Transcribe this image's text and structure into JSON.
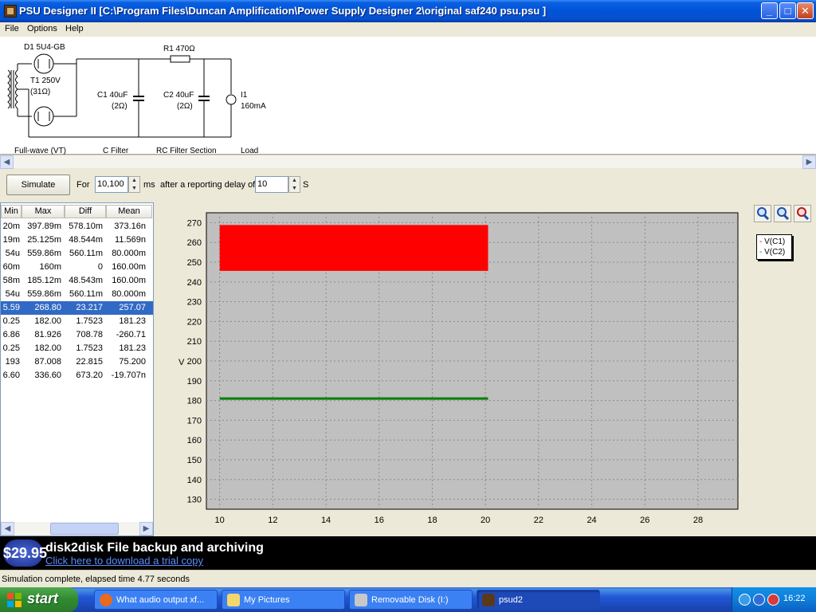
{
  "window": {
    "title": "PSU Designer II  [C:\\Program Files\\Duncan Amplification\\Power Supply Designer 2\\original saf240 psu.psu ]",
    "minimize": "_",
    "maximize": "□",
    "close": "✕"
  },
  "menu": [
    "File",
    "Options",
    "Help"
  ],
  "schematic": {
    "d1": "D1 5U4-GB",
    "r1": "R1 470Ω",
    "t1": "T1 250V",
    "t1_res": "(31Ω)",
    "c1": "C1 40uF",
    "c1_res": "(2Ω)",
    "c2": "C2 40uF",
    "c2_res": "(2Ω)",
    "i1": "I1",
    "i1_val": "160mA",
    "sec_rect": "Full-wave (VT)",
    "sec_cfilter": "C Filter",
    "sec_rc": "RC Filter Section",
    "sec_load": "Load"
  },
  "controls": {
    "simulate": "Simulate",
    "for": "For",
    "duration": "10,100",
    "ms": "ms",
    "after": "after a reporting delay of",
    "delay": "10",
    "s": "S"
  },
  "table": {
    "headers": [
      "Min",
      "Max",
      "Diff",
      "Mean"
    ],
    "rows": [
      [
        "20m",
        "397.89m",
        "578.10m",
        "373.16n"
      ],
      [
        "19m",
        "25.125m",
        "48.544m",
        "11.569n"
      ],
      [
        "54u",
        "559.86m",
        "560.11m",
        "80.000m"
      ],
      [
        "60m",
        "160m",
        "0",
        "160.00m"
      ],
      [
        "58m",
        "185.12m",
        "48.543m",
        "160.00m"
      ],
      [
        "54u",
        "559.86m",
        "560.11m",
        "80.000m"
      ],
      [
        "5.59",
        "268.80",
        "23.217",
        "257.07"
      ],
      [
        "0.25",
        "182.00",
        "1.7523",
        "181.23"
      ],
      [
        "6.86",
        "81.926",
        "708.78",
        "-260.71"
      ],
      [
        "0.25",
        "182.00",
        "1.7523",
        "181.23"
      ],
      [
        "193",
        "87.008",
        "22.815",
        "75.200"
      ],
      [
        "6.60",
        "336.60",
        "673.20",
        "-19.707n"
      ]
    ],
    "selected_row": 6
  },
  "chart_data": {
    "type": "line",
    "xlim": [
      9.5,
      29.5
    ],
    "ylim": [
      125,
      275
    ],
    "xticks": [
      10,
      12,
      14,
      16,
      18,
      20,
      22,
      24,
      26,
      28
    ],
    "yticks": [
      130,
      140,
      150,
      160,
      170,
      180,
      190,
      200,
      210,
      220,
      230,
      240,
      250,
      260,
      270
    ],
    "ylabel": "V",
    "grid": true,
    "legend_position": "top-right outside",
    "series": [
      {
        "name": "V(C1)",
        "color": "#ff0000",
        "x_range": [
          10,
          20.1
        ],
        "y_min": 245.6,
        "y_max": 268.8
      },
      {
        "name": "V(C2)",
        "color": "#008000",
        "x_range": [
          10,
          20.1
        ],
        "y_min": 180.8,
        "y_max": 181.6
      }
    ]
  },
  "banner": {
    "price": "$29.95",
    "title": "disk2disk File backup and archiving",
    "link": "Click here to download a trial copy"
  },
  "status": "Simulation complete, elapsed time 4.77 seconds",
  "taskbar": {
    "start": "start",
    "tasks": [
      "What audio output xf...",
      "My Pictures",
      "Removable Disk (I:)",
      "psud2"
    ],
    "clock": "16:22"
  }
}
